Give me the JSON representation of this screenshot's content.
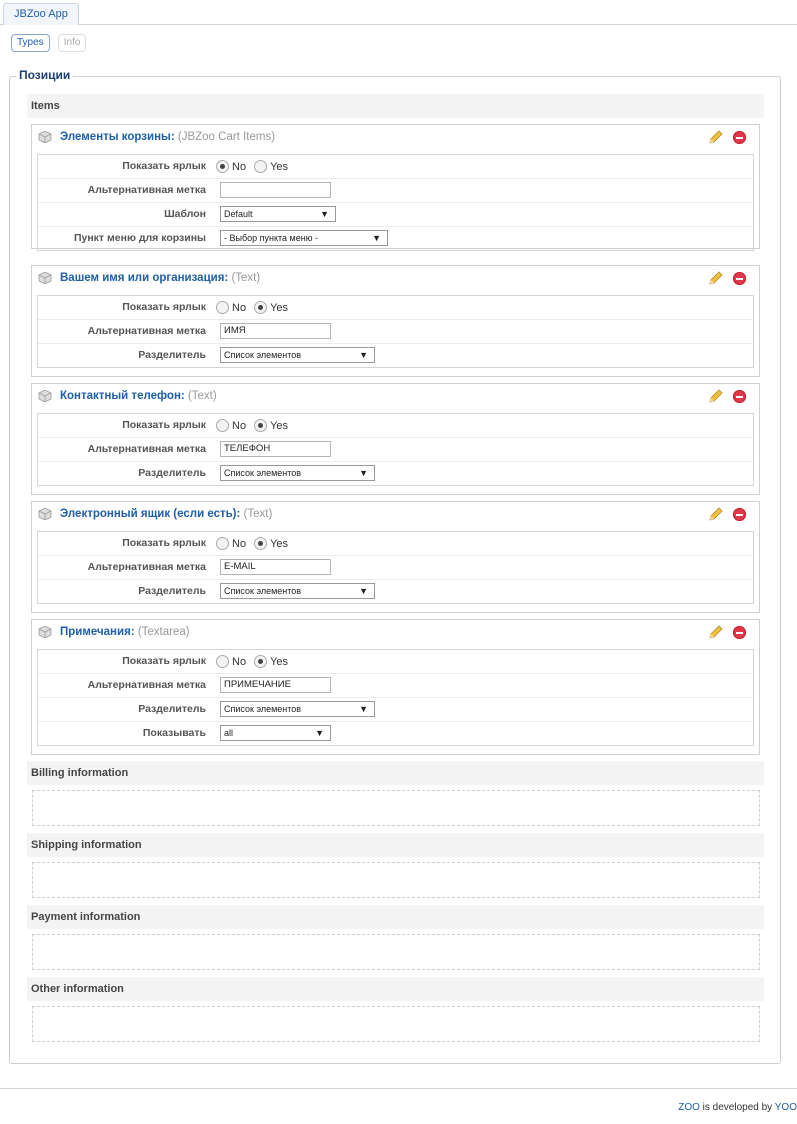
{
  "app_tab": "JBZoo App",
  "subnav": {
    "types": "Types",
    "info": "Info"
  },
  "legend": "Позиции",
  "sections": {
    "items": "Items",
    "billing": "Billing information",
    "shipping": "Shipping information",
    "payment": "Payment information",
    "other": "Other information"
  },
  "elements": [
    {
      "name": "Элементы корзины:",
      "type": "(JBZoo Cart Items)",
      "rows": [
        {
          "label": "Показать ярлык",
          "no": "No",
          "yes": "Yes",
          "selected": "no"
        },
        {
          "label": "Альтернативная метка",
          "value": ""
        },
        {
          "label": "Шаблон",
          "value": "Default"
        },
        {
          "label": "Пункт меню для корзины",
          "value": "- Выбор пункта меню -"
        }
      ]
    },
    {
      "name": "Вашем имя или организация:",
      "type": "(Text)",
      "rows": [
        {
          "label": "Показать ярлык",
          "no": "No",
          "yes": "Yes",
          "selected": "yes"
        },
        {
          "label": "Альтернативная метка",
          "value": "ИМЯ"
        },
        {
          "label": "Разделитель",
          "value": "Список элементов"
        }
      ]
    },
    {
      "name": "Контактный телефон:",
      "type": "(Text)",
      "rows": [
        {
          "label": "Показать ярлык",
          "no": "No",
          "yes": "Yes",
          "selected": "yes"
        },
        {
          "label": "Альтернативная метка",
          "value": "ТЕЛЕФОН"
        },
        {
          "label": "Разделитель",
          "value": "Список элементов"
        }
      ]
    },
    {
      "name": "Электронный ящик (если есть):",
      "type": "(Text)",
      "rows": [
        {
          "label": "Показать ярлык",
          "no": "No",
          "yes": "Yes",
          "selected": "yes"
        },
        {
          "label": "Альтернативная метка",
          "value": "E-MAIL"
        },
        {
          "label": "Разделитель",
          "value": "Список элементов"
        }
      ]
    },
    {
      "name": "Примечания:",
      "type": "(Textarea)",
      "rows": [
        {
          "label": "Показать ярлык",
          "no": "No",
          "yes": "Yes",
          "selected": "yes"
        },
        {
          "label": "Альтернативная метка",
          "value": "ПРИМЕЧАНИЕ"
        },
        {
          "label": "Разделитель",
          "value": "Список элементов"
        },
        {
          "label": "Показывать",
          "value": "all"
        }
      ]
    }
  ],
  "footer": {
    "zoo": "ZOO",
    "middle": " is developed by ",
    "yoo": "YOO"
  },
  "colors": {
    "link": "#1f5fa8",
    "remove": "#e0384a",
    "pencil": "#e8b93a"
  }
}
